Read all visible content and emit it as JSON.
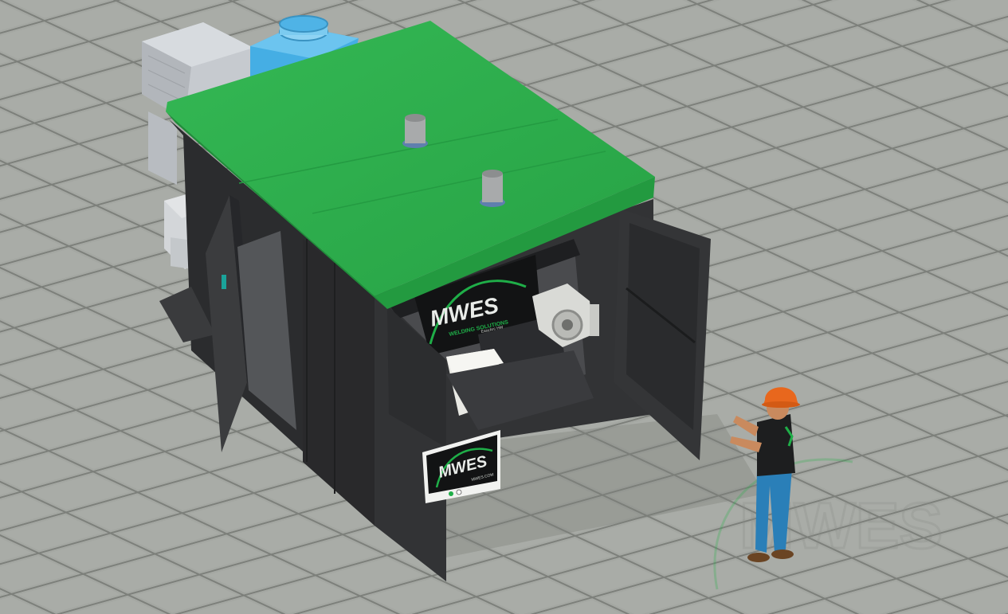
{
  "logos": {
    "booth_logo": {
      "text": "MWES",
      "tagline": "WELDING SOLUTIONS",
      "sub": "EasyArc HW"
    },
    "panel_sign": {
      "text": "MWES",
      "sub": "MWES.COM"
    },
    "watermark": {
      "text": "MWES"
    }
  },
  "colors": {
    "floor_tile": "#a4a7a2",
    "floor_line": "#7d807b",
    "roof_green": "#2dae4c",
    "roof_green_dark": "#1f8f3a",
    "cabinet_black": "#2e2f31",
    "cabinet_black_dark": "#222325",
    "chiller_gray": "#c6cacf",
    "duct_blue": "#45aee4",
    "hardhat_orange": "#e8671d",
    "jeans_blue": "#2a7fb8",
    "logo_green": "#1fae48"
  },
  "icons": [
    "vent-stack-icon",
    "logo-swoosh-icon",
    "indicator-light-icon"
  ]
}
